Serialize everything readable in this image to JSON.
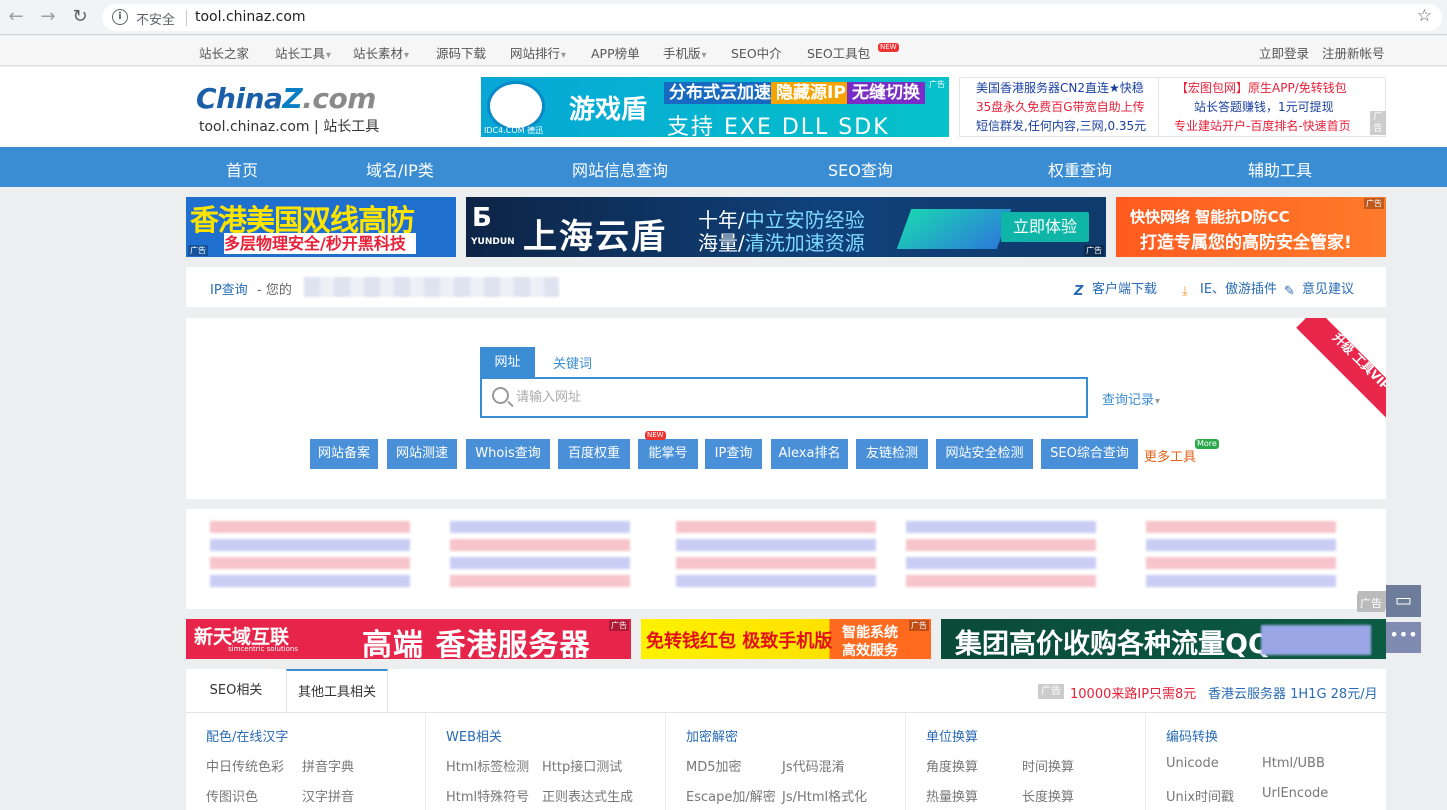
{
  "browser": {
    "insecure_label": "不安全",
    "url": "tool.chinaz.com"
  },
  "topnav": {
    "items": [
      "站长之家",
      "站长工具",
      "站长素材",
      "源码下载",
      "网站排行",
      "APP榜单",
      "手机版",
      "SEO中介",
      "SEO工具包"
    ],
    "new_tag": "NEW",
    "login": "立即登录",
    "register": "注册新帐号"
  },
  "header": {
    "logo_china": "China",
    "logo_z": "Z",
    "logo_com": ".com",
    "logo_sub": "tool.chinaz.com | 站长工具",
    "ad1": {
      "name": "游戏盾",
      "badge1": "分布式云加速",
      "badge2": "隐藏源IP",
      "badge3": "无缝切换",
      "foot": "支持 EXE DLL SDK",
      "idc": "IDC4.COM 德迅",
      "corner": "广告"
    },
    "ad2_lines": [
      "美国香港服务器CN2直连★快稳",
      "35盘永久免费百G带宽自助上传",
      "短信群发,任何内容,三网,0.35元"
    ],
    "ad3_lines": [
      "【宏图包网】原生APP/免转钱包",
      "站长答题赚钱，1元可提现",
      "专业建站开户-百度排名-快速首页"
    ],
    "ad_corner": "广告"
  },
  "mainnav": [
    "首页",
    "域名/IP类",
    "网站信息查询",
    "SEO查询",
    "权重查询",
    "辅助工具"
  ],
  "banners": {
    "b1_line1": "香港美国双线高防",
    "b1_line2": "多层物理安全/秒开黑科技",
    "b2_logo": "YUNDUN",
    "b2_name": "上海云盾",
    "b2_l1a": "十年/",
    "b2_l1b": "中立安防经验",
    "b2_l2a": "海量/",
    "b2_l2b": "清洗加速资源",
    "b2_btn": "立即体验",
    "b3_line1": "快快网络  智能抗D防CC",
    "b3_line2": "打造专属您的高防安全管家!",
    "corner": "广告"
  },
  "ipbar": {
    "label": "IP查询",
    "yours": "- 您的",
    "client": "客户端下载",
    "plugin": "IE、傲游插件",
    "feedback": "意见建议"
  },
  "search": {
    "tab_url": "网址",
    "tab_keyword": "关键词",
    "placeholder": "请输入网址",
    "history": "查询记录",
    "buttons": [
      "网站备案",
      "网站测速",
      "Whois查询",
      "百度权重",
      "能掌号",
      "IP查询",
      "Alexa排名",
      "友链检测",
      "网站安全检测",
      "SEO综合查询"
    ],
    "new_tag": "NEW",
    "more": "更多工具",
    "more_tag": "More",
    "vip": "升级 工具VIP"
  },
  "strip_ad": "广告",
  "banners2": {
    "b1_logo": "新天域互联",
    "b1_sub": "simcentric solutions",
    "b1_big": "高端 香港服务器",
    "b2_left": "免转钱红包 极致手机版",
    "b2_r1": "智能系统",
    "b2_r2": "高效服务",
    "b3_text": "集团高价收购各种流量QQ:",
    "corner": "广告"
  },
  "bottom": {
    "tabs": [
      "SEO相关",
      "其他工具相关"
    ],
    "ad_tag": "广告",
    "ad_link1": "10000来路IP只需8元",
    "ad_link2": "香港云服务器 1H1G 28元/月",
    "columns": [
      {
        "title": "配色/在线汉字",
        "items": [
          "中日传统色彩",
          "拼音字典",
          "传图识色",
          "汉字拼音"
        ]
      },
      {
        "title": "WEB相关",
        "items": [
          "Html标签检测",
          "Http接口测试",
          "Html特殊符号",
          "正则表达式生成"
        ]
      },
      {
        "title": "加密解密",
        "items": [
          "MD5加密",
          "Js代码混淆",
          "Escape加/解密",
          "Js/Html格式化"
        ]
      },
      {
        "title": "单位换算",
        "items": [
          "角度换算",
          "时间换算",
          "热量换算",
          "长度换算"
        ]
      },
      {
        "title": "编码转换",
        "items": [
          "Unicode",
          "Html/UBB",
          "Unix时间戳",
          "UrlEncode"
        ]
      }
    ]
  },
  "colors": {
    "brand_blue": "#3b8dd3",
    "link_blue": "#2a6bb5",
    "accent_red": "#e8213a",
    "more_orange": "#e0631a"
  }
}
